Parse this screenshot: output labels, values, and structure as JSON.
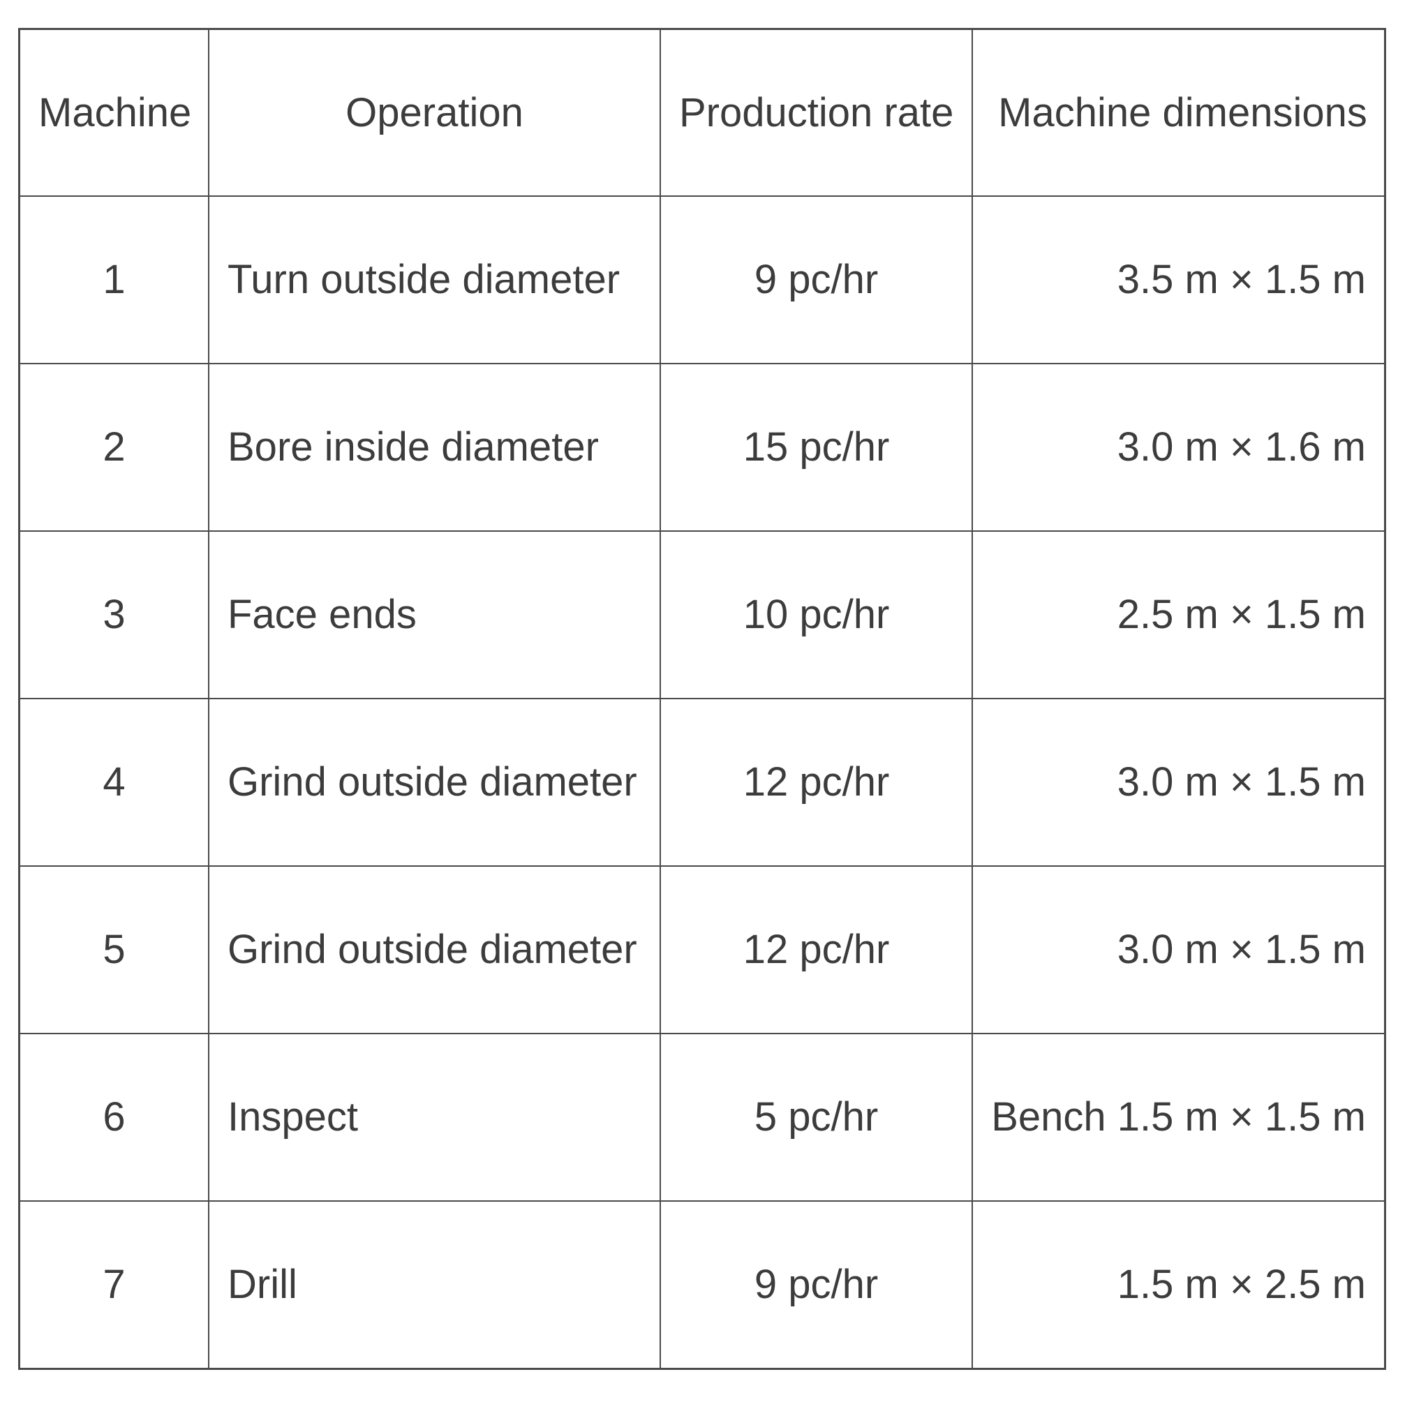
{
  "table": {
    "columns": [
      {
        "key": "machine",
        "label": "Machine"
      },
      {
        "key": "operation",
        "label": "Operation"
      },
      {
        "key": "rate",
        "label": "Production rate"
      },
      {
        "key": "dimensions",
        "label": "Machine dimensions"
      }
    ],
    "rows": [
      {
        "machine": "1",
        "operation": "Turn outside diameter",
        "rate": "9 pc/hr",
        "dimensions": "3.5 m × 1.5 m"
      },
      {
        "machine": "2",
        "operation": "Bore inside diameter",
        "rate": "15 pc/hr",
        "dimensions": "3.0 m × 1.6 m"
      },
      {
        "machine": "3",
        "operation": "Face ends",
        "rate": "10 pc/hr",
        "dimensions": "2.5 m × 1.5 m"
      },
      {
        "machine": "4",
        "operation": "Grind outside diameter",
        "rate": "12 pc/hr",
        "dimensions": "3.0 m × 1.5 m"
      },
      {
        "machine": "5",
        "operation": "Grind outside diameter",
        "rate": "12 pc/hr",
        "dimensions": "3.0 m × 1.5 m"
      },
      {
        "machine": "6",
        "operation": "Inspect",
        "rate": "5 pc/hr",
        "dimensions": "Bench 1.5 m × 1.5 m"
      },
      {
        "machine": "7",
        "operation": "Drill",
        "rate": "9 pc/hr",
        "dimensions": "1.5 m × 2.5 m"
      }
    ]
  },
  "style": {
    "text_color": "#3c3c3c",
    "border_color": "#4a4a4a",
    "background": "#ffffff"
  }
}
